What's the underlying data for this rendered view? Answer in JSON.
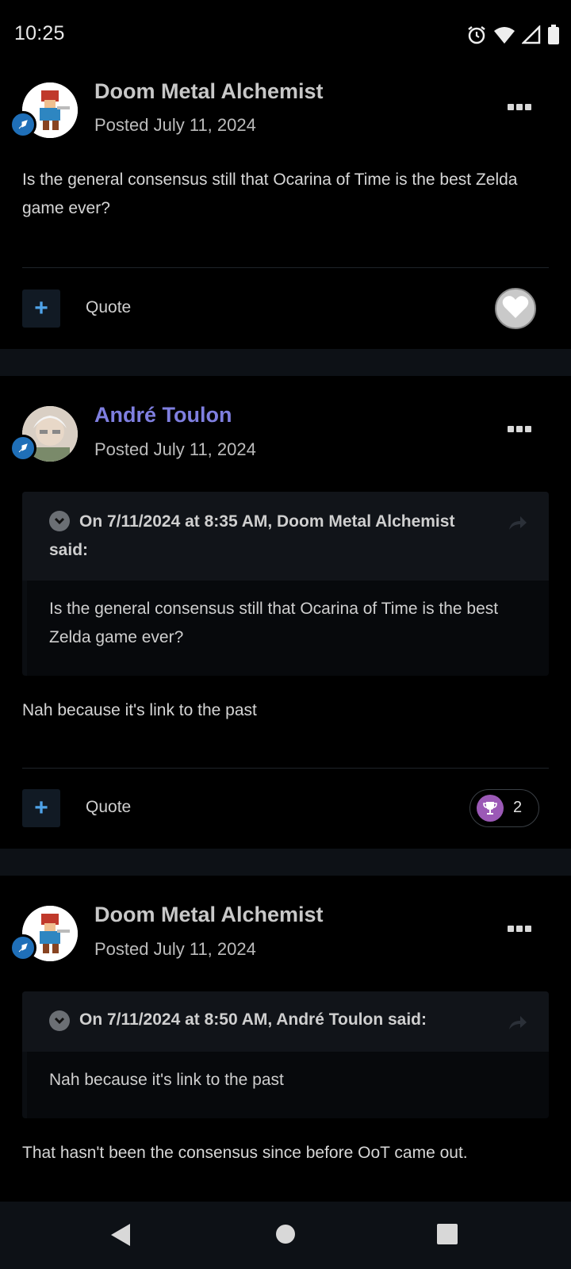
{
  "status_bar": {
    "time": "10:25",
    "icons": [
      "alarm-icon",
      "wifi-icon",
      "signal-icon",
      "battery-icon"
    ]
  },
  "posts": [
    {
      "author": "Doom Metal Alchemist",
      "posted": "Posted July 11, 2024",
      "body": "Is the general consensus still that Ocarina of Time is the best Zelda game ever?",
      "quote_label": "Quote",
      "reaction": {
        "type": "like",
        "icon": "heart-icon"
      }
    },
    {
      "author": "André Toulon",
      "posted": "Posted July 11, 2024",
      "quote": {
        "citation": "On 7/11/2024 at 8:35 AM, Doom Metal Alchemist said:",
        "text": "Is the general consensus still that Ocarina of Time is the best Zelda game ever?"
      },
      "body": "Nah because it's link to the past",
      "quote_label": "Quote",
      "reaction": {
        "icon": "trophy-icon",
        "count": "2",
        "color": "#9b59b6"
      }
    },
    {
      "author": "Doom Metal Alchemist",
      "posted": "Posted July 11, 2024",
      "quote": {
        "citation": "On 7/11/2024 at 8:50 AM, André Toulon said:",
        "text": "Nah because it's link to the past"
      },
      "body": "That hasn't been the consensus since before OoT came out."
    }
  ],
  "nav_bar": {
    "buttons": [
      "back-icon",
      "home-icon",
      "recents-icon"
    ]
  },
  "colors": {
    "background": "#000000",
    "accent_link": "#7f7fe0",
    "plus_blue": "#4fa3e8",
    "badge_blue": "#1f6fb8"
  }
}
